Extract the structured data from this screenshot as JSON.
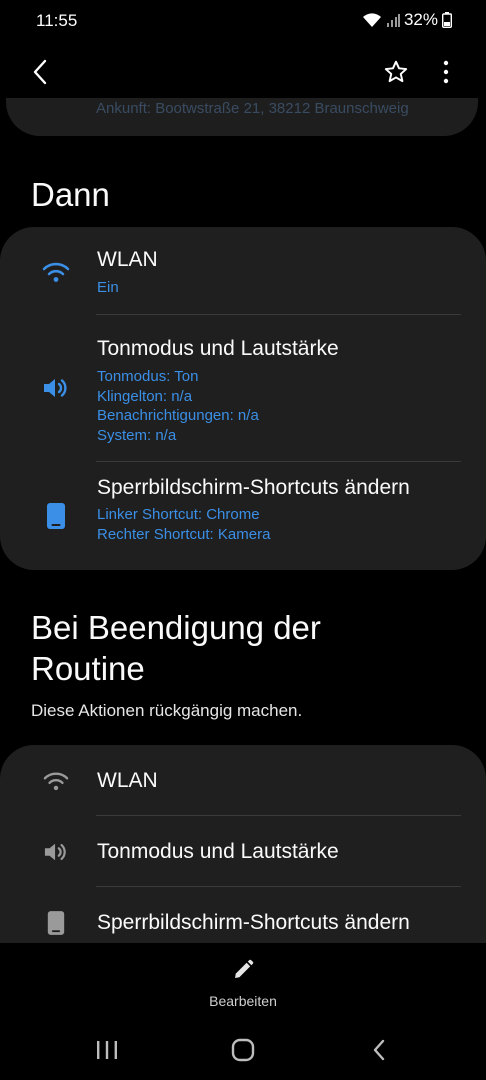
{
  "status_bar": {
    "time": "11:55",
    "battery": "32%"
  },
  "app_bar": {
    "back": "back-icon",
    "favorite": "star-icon",
    "more": "more-vertical-icon"
  },
  "previous_card": {
    "text": "Ankunft: Bootwstraße 21, 38212 Braunschweig"
  },
  "then_section": {
    "title": "Dann",
    "items": [
      {
        "icon": "wifi-icon",
        "title": "WLAN",
        "details": [
          "Ein"
        ]
      },
      {
        "icon": "volume-icon",
        "title": "Tonmodus und Lautstärke",
        "details": [
          "Tonmodus: Ton",
          "Klingelton: n/a",
          "Benachrichtigungen: n/a",
          "System: n/a"
        ]
      },
      {
        "icon": "phone-icon",
        "title": "Sperrbildschirm-Shortcuts ändern",
        "details": [
          "Linker Shortcut: Chrome",
          "Rechter Shortcut: Kamera"
        ]
      }
    ]
  },
  "end_section": {
    "title_line1": "Bei Beendigung der",
    "title_line2": "Routine",
    "subtitle": "Diese Aktionen rückgängig machen.",
    "items": [
      {
        "icon": "wifi-icon",
        "title": "WLAN"
      },
      {
        "icon": "volume-icon",
        "title": "Tonmodus und Lautstärke"
      },
      {
        "icon": "phone-icon",
        "title": "Sperrbildschirm-Shortcuts ändern"
      }
    ]
  },
  "bottom_action": {
    "label": "Bearbeiten",
    "icon": "pencil-icon"
  },
  "colors": {
    "accent": "#3b8fe6",
    "card": "#1f1f1f",
    "background": "#000000"
  }
}
